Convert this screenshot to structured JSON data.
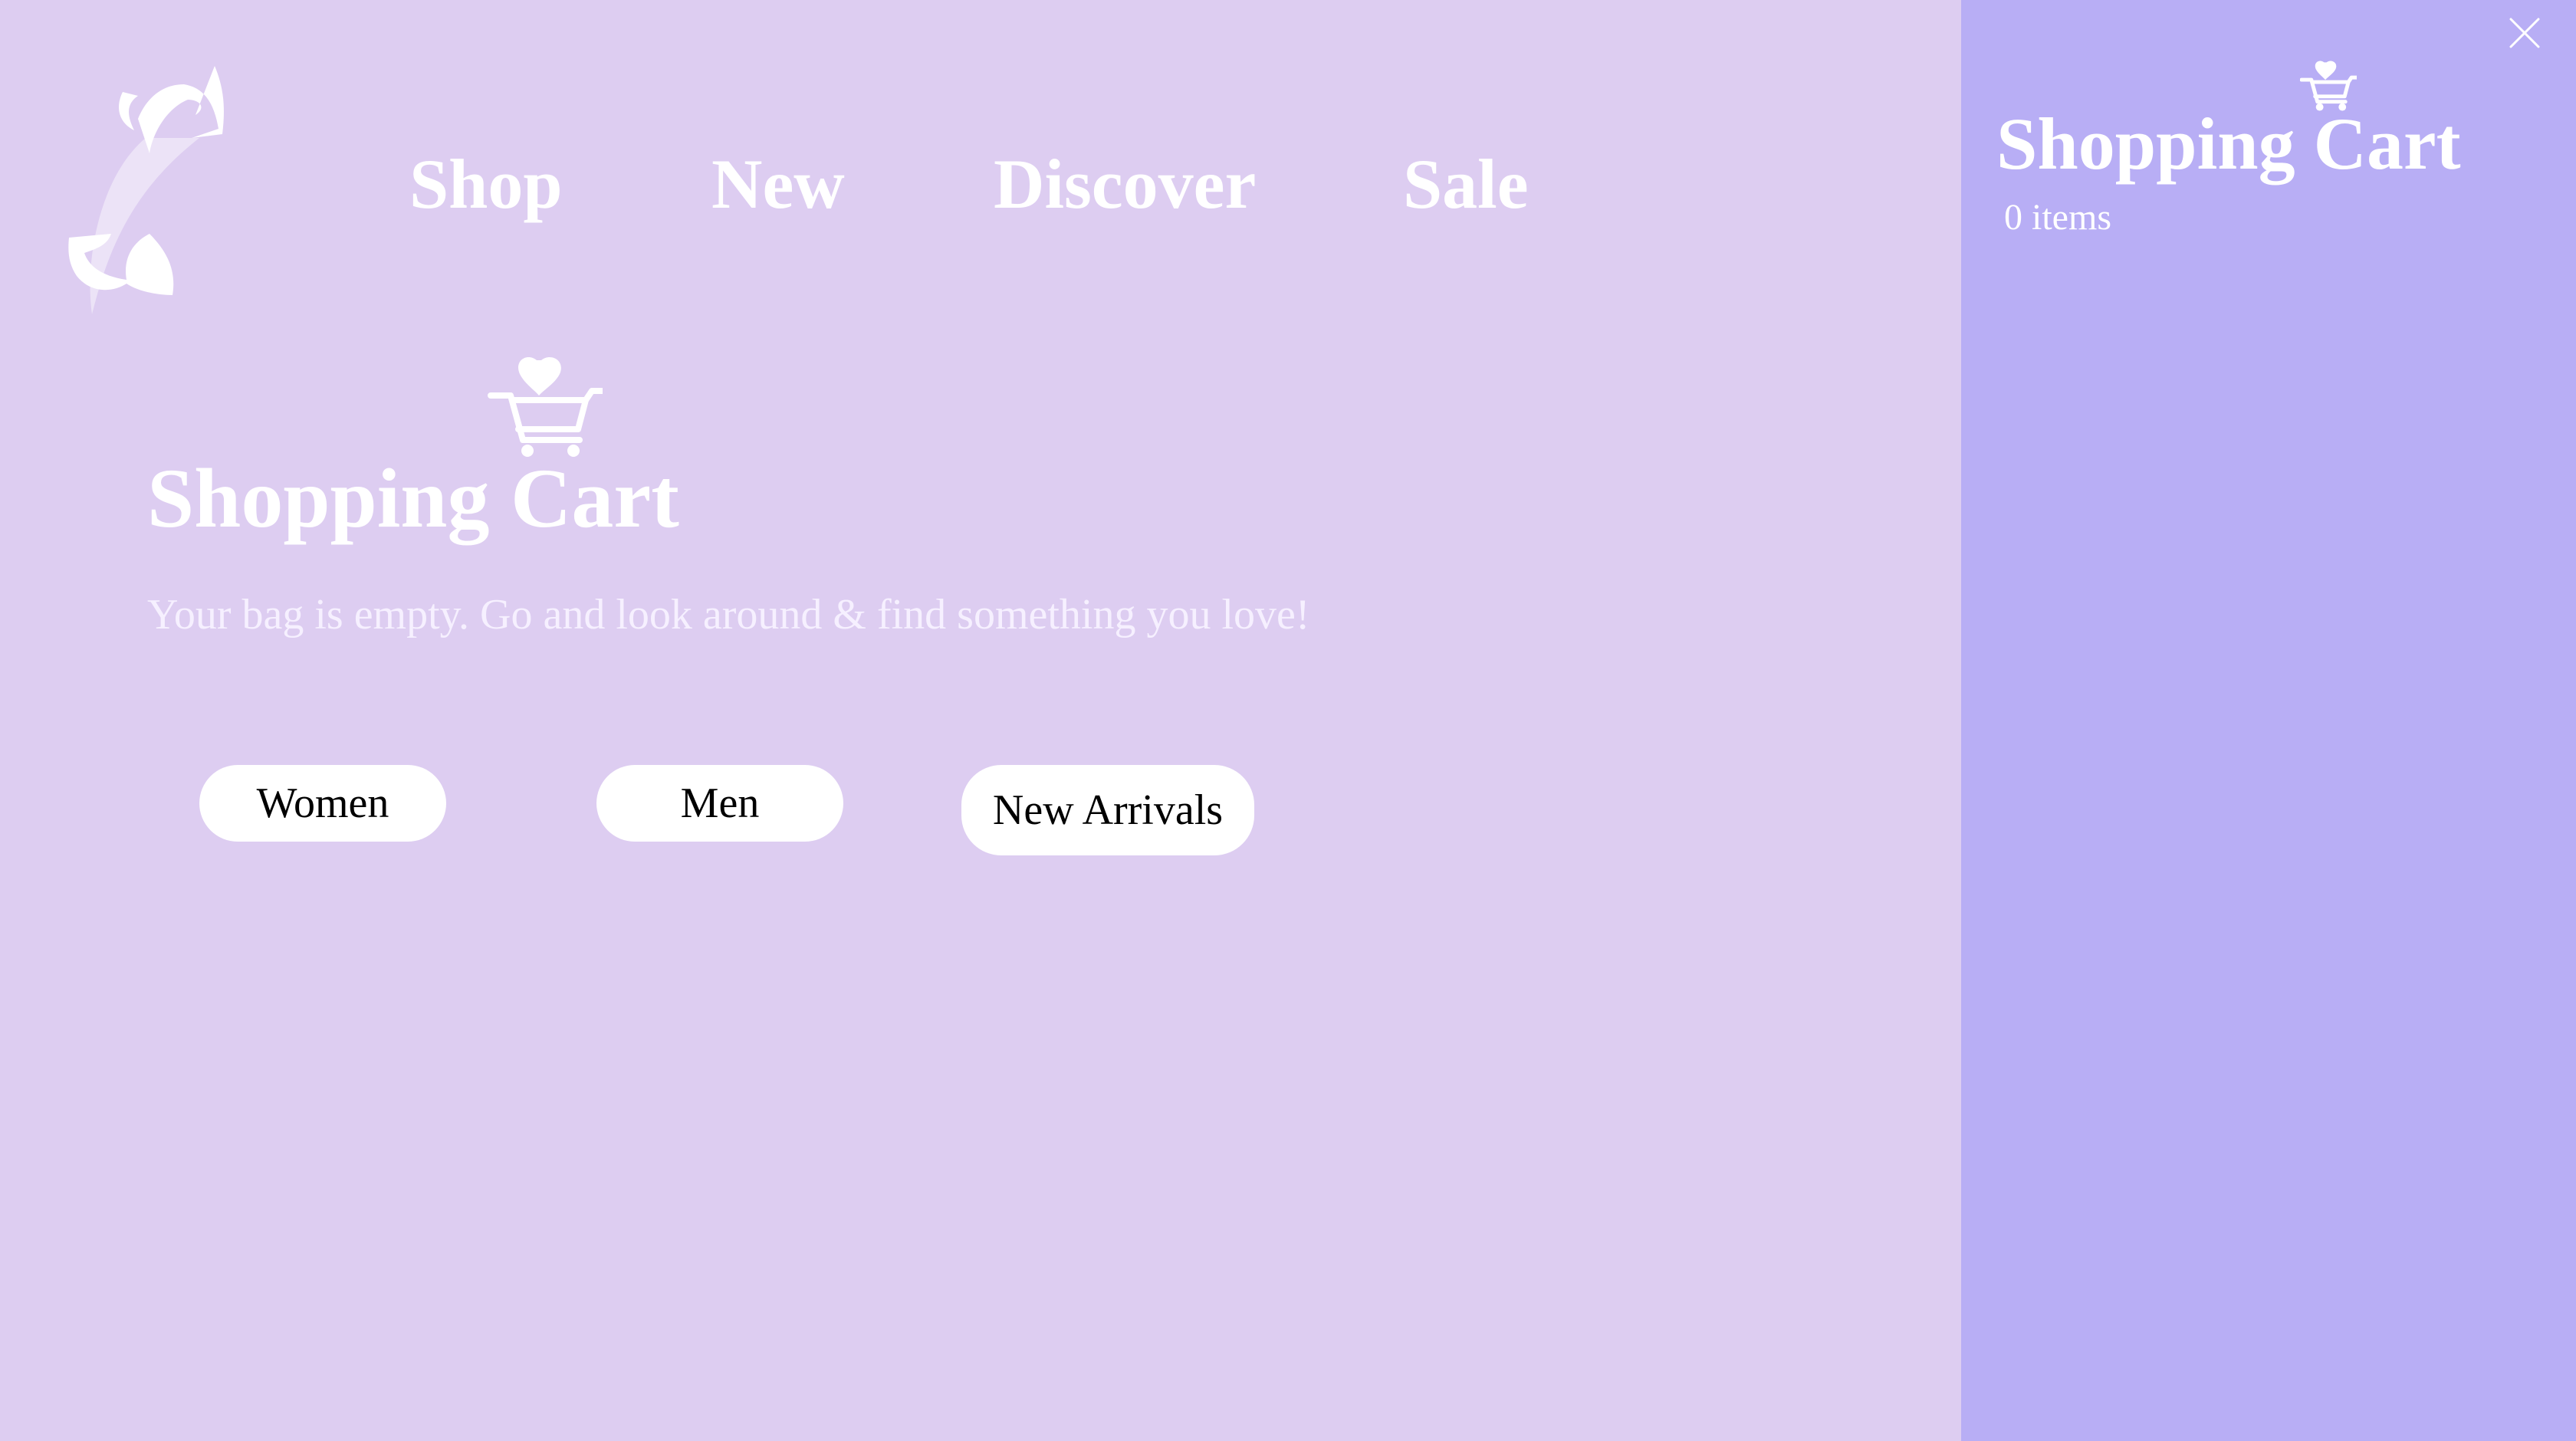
{
  "nav": {
    "items": [
      {
        "label": "Shop"
      },
      {
        "label": "New"
      },
      {
        "label": "Discover"
      },
      {
        "label": "Sale"
      }
    ]
  },
  "main": {
    "title": "Shopping Cart",
    "message": "Your bag is empty. Go and look around & find something you love!",
    "buttons": [
      {
        "label": "Women"
      },
      {
        "label": "Men"
      },
      {
        "label": "New Arrivals"
      }
    ]
  },
  "cart_panel": {
    "title": "Shopping Cart",
    "count_text": "0 items"
  },
  "icons": {
    "logo": "brand-logo",
    "cart": "heart-cart-icon",
    "close": "close-icon"
  },
  "colors": {
    "page_background": "#ddcdf1",
    "panel_background": "#b8aef5",
    "text": "#ffffff",
    "button_background": "#ffffff",
    "button_text": "#000000"
  }
}
